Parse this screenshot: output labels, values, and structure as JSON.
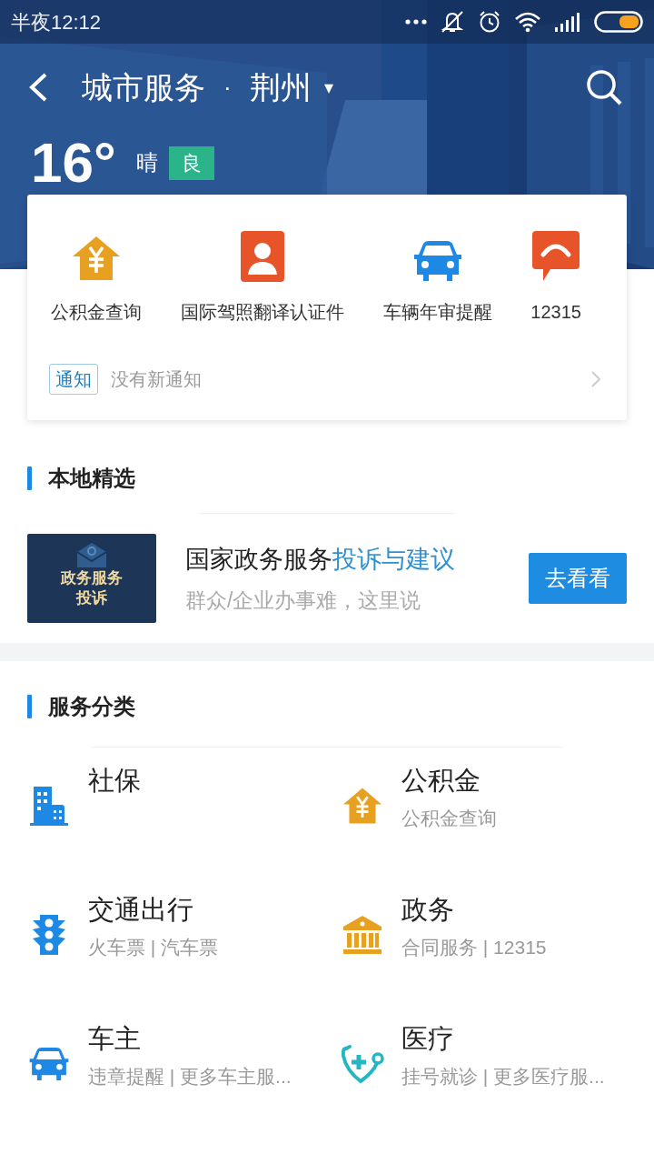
{
  "status_bar": {
    "time": "半夜12:12"
  },
  "nav": {
    "title": "城市服务",
    "separator": "·",
    "city": "荆州",
    "dropdown": "▾"
  },
  "weather": {
    "temperature": "16°",
    "condition": "晴",
    "air_quality": "良"
  },
  "quick_services": [
    {
      "label": "公积金查询"
    },
    {
      "label": "国际驾照翻译认证件"
    },
    {
      "label": "车辆年审提醒"
    },
    {
      "label": "12315"
    }
  ],
  "notice": {
    "tag": "通知",
    "text": "没有新通知"
  },
  "local_picks": {
    "title": "本地精选",
    "banner_text": [
      "政务服务",
      "投诉"
    ],
    "headline": "国家政务服务**投诉与建议**",
    "subtitle": "群众/企业办事难，这里说",
    "button": "去看看"
  },
  "categories": {
    "title": "服务分类",
    "items": [
      {
        "title": "社保"
      },
      {
        "title": "公积金",
        "subtitle": "公积金查询"
      },
      {
        "title": "交通出行",
        "subtitle": "火车票 | 汽车票"
      },
      {
        "title": "政务",
        "subtitle": "合同服务 | 12315"
      },
      {
        "title": "车主",
        "subtitle": "违章提醒 | 更多车主服..."
      },
      {
        "title": "医疗",
        "subtitle": "挂号就诊 | 更多医疗服..."
      }
    ]
  }
}
